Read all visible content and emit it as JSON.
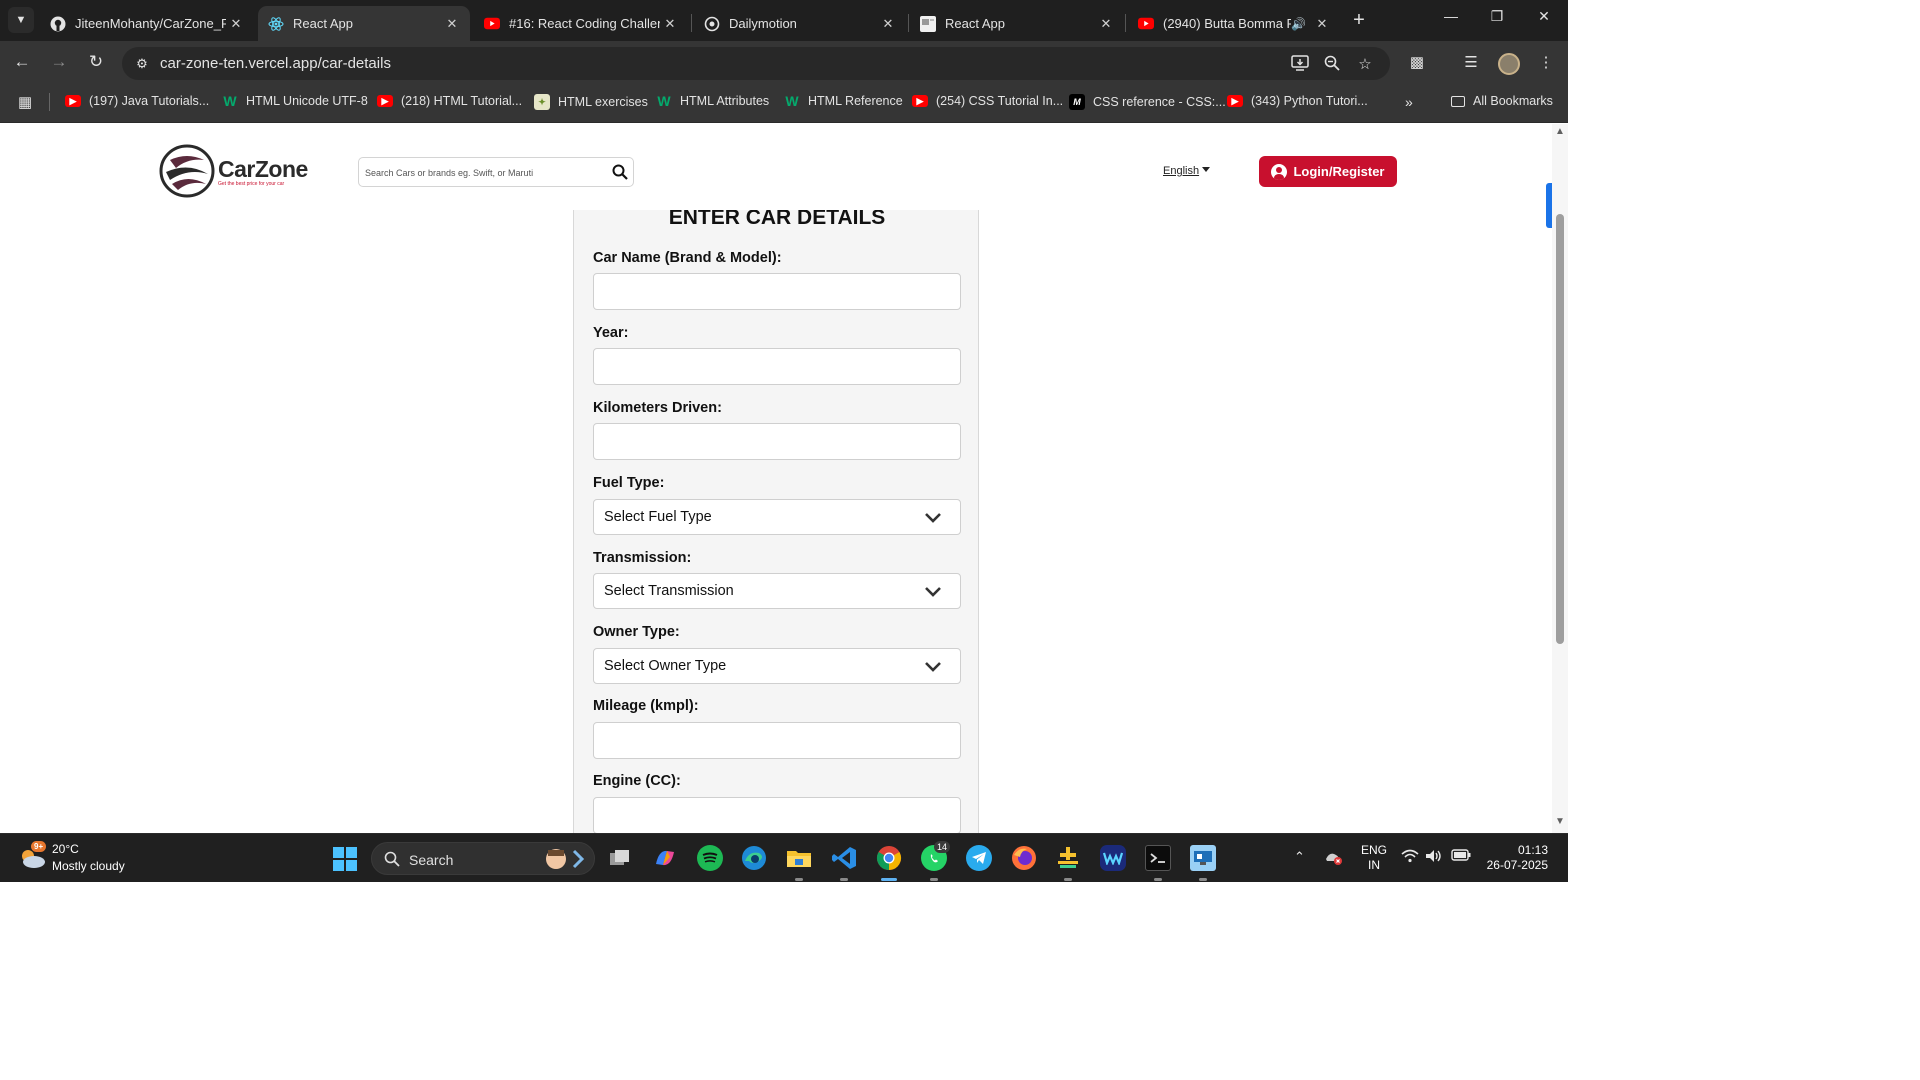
{
  "browser": {
    "tabs": [
      {
        "title": "JiteenMohanty/CarZone_R",
        "icon": "github-icon",
        "active": false
      },
      {
        "title": "React App",
        "icon": "react-icon",
        "active": true
      },
      {
        "title": "#16: React Coding Challen",
        "icon": "youtube-icon",
        "active": false
      },
      {
        "title": "Dailymotion",
        "icon": "dailymotion-icon",
        "active": false
      },
      {
        "title": "React App",
        "icon": "react-app-icon",
        "active": false
      },
      {
        "title": "(2940) Butta Bomma F",
        "icon": "youtube-icon",
        "active": false
      }
    ],
    "url": "car-zone-ten.vercel.app/car-details",
    "bookmarks": [
      {
        "label": "(197) Java Tutorials...",
        "icon": "youtube-icon"
      },
      {
        "label": "HTML Unicode UTF-8",
        "icon": "w3schools-icon"
      },
      {
        "label": "(218) HTML Tutorial...",
        "icon": "youtube-icon"
      },
      {
        "label": "HTML exercises",
        "icon": "html-exercises-icon"
      },
      {
        "label": "HTML Attributes",
        "icon": "w3schools-icon"
      },
      {
        "label": "HTML Reference",
        "icon": "w3schools-icon"
      },
      {
        "label": "(254) CSS Tutorial In...",
        "icon": "youtube-icon"
      },
      {
        "label": "CSS reference - CSS:...",
        "icon": "mdn-icon"
      },
      {
        "label": "(343) Python Tutori...",
        "icon": "youtube-icon"
      }
    ],
    "all_bookmarks": "All Bookmarks"
  },
  "site": {
    "logo_name": "CarZone",
    "logo_tagline": "Get the best price for your car",
    "search_placeholder": "Search Cars or brands eg. Swift, or Maruti",
    "language": "English",
    "login_label": "Login/Register",
    "accent_color": "#c8102e"
  },
  "form": {
    "title": "ENTER CAR DETAILS",
    "fields": {
      "car_name": {
        "label": "Car Name (Brand & Model):",
        "value": ""
      },
      "year": {
        "label": "Year:",
        "value": ""
      },
      "km_driven": {
        "label": "Kilometers Driven:",
        "value": ""
      },
      "fuel_type": {
        "label": "Fuel Type:",
        "selected": "Select Fuel Type"
      },
      "transmission": {
        "label": "Transmission:",
        "selected": "Select Transmission"
      },
      "owner_type": {
        "label": "Owner Type:",
        "selected": "Select Owner Type"
      },
      "mileage": {
        "label": "Mileage (kmpl):",
        "value": ""
      },
      "engine": {
        "label": "Engine (CC):",
        "value": ""
      }
    }
  },
  "taskbar": {
    "weather_badge": "9+",
    "temperature": "20°C",
    "weather": "Mostly cloudy",
    "search_label": "Search",
    "whatsapp_badge": "14",
    "lang_line1": "ENG",
    "lang_line2": "IN",
    "time": "01:13",
    "date": "26-07-2025"
  }
}
